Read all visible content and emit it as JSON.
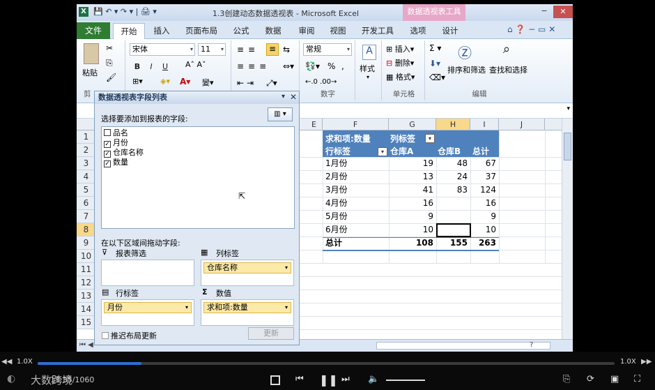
{
  "window": {
    "title": "1.3创建动态数据透视表 - Microsoft Excel",
    "context_tab": "数据透视表工具",
    "controls": [
      "−",
      "▭",
      "✕"
    ]
  },
  "ribbon_tabs": [
    "文件",
    "开始",
    "插入",
    "页面布局",
    "公式",
    "数据",
    "审阅",
    "视图",
    "开发工具",
    "选项",
    "设计"
  ],
  "ribbon": {
    "paste": "粘贴",
    "clipboard_group": "剪",
    "font_name": "宋体",
    "font_size": "11",
    "number_format": "常规",
    "number_group": "数字",
    "styles": "样式",
    "insert": "插入",
    "delete": "删除",
    "format": "格式",
    "cells_group": "单元格",
    "sort_filter": "排序和筛选",
    "find_select": "查找和选择",
    "edit_group": "编辑",
    "bold": "B",
    "italic": "I",
    "underline": "U",
    "percent": "%",
    "comma": ","
  },
  "sheet": {
    "columns": [
      "E",
      "F",
      "G",
      "H",
      "I",
      "J"
    ],
    "rows": [
      "1",
      "2",
      "3",
      "4",
      "5",
      "6",
      "7",
      "8",
      "9",
      "10",
      "11",
      "12",
      "13",
      "14",
      "15"
    ],
    "selected_row": "8",
    "selected_col": "H"
  },
  "pivot": {
    "title": "求和项:数量",
    "col_label": "列标签",
    "row_label": "行标签",
    "col_a": "仓库A",
    "col_b": "仓库B",
    "col_total": "总计",
    "rows": [
      {
        "label": "1月份",
        "a": "19",
        "b": "48",
        "t": "67"
      },
      {
        "label": "2月份",
        "a": "13",
        "b": "24",
        "t": "37"
      },
      {
        "label": "3月份",
        "a": "41",
        "b": "83",
        "t": "124"
      },
      {
        "label": "4月份",
        "a": "16",
        "b": "",
        "t": "16"
      },
      {
        "label": "5月份",
        "a": "9",
        "b": "",
        "t": "9"
      },
      {
        "label": "6月份",
        "a": "10",
        "b": "",
        "t": "10"
      }
    ],
    "total_label": "总计",
    "total_a": "108",
    "total_b": "155",
    "total_all": "263"
  },
  "field_panel": {
    "title": "数据透视表字段列表",
    "choose_label": "选择要添加到报表的字段:",
    "fields": [
      {
        "name": "品名",
        "checked": false
      },
      {
        "name": "月份",
        "checked": true
      },
      {
        "name": "仓库名称",
        "checked": true
      },
      {
        "name": "数量",
        "checked": true
      }
    ],
    "drag_label": "在以下区域间拖动字段:",
    "filter_label": "报表筛选",
    "column_area_label": "列标签",
    "column_field": "仓库名称",
    "row_area_label": "行标签",
    "row_field": "月份",
    "values_area_label": "数值",
    "values_field": "求和项:数量",
    "defer_label": "推迟布局更新",
    "update_button": "更新"
  },
  "player": {
    "speed_left": "1.0X",
    "speed_right": "1.0X",
    "progress_fraction": 0.18,
    "time": "13:35/1060",
    "brand": "大数跨境"
  }
}
